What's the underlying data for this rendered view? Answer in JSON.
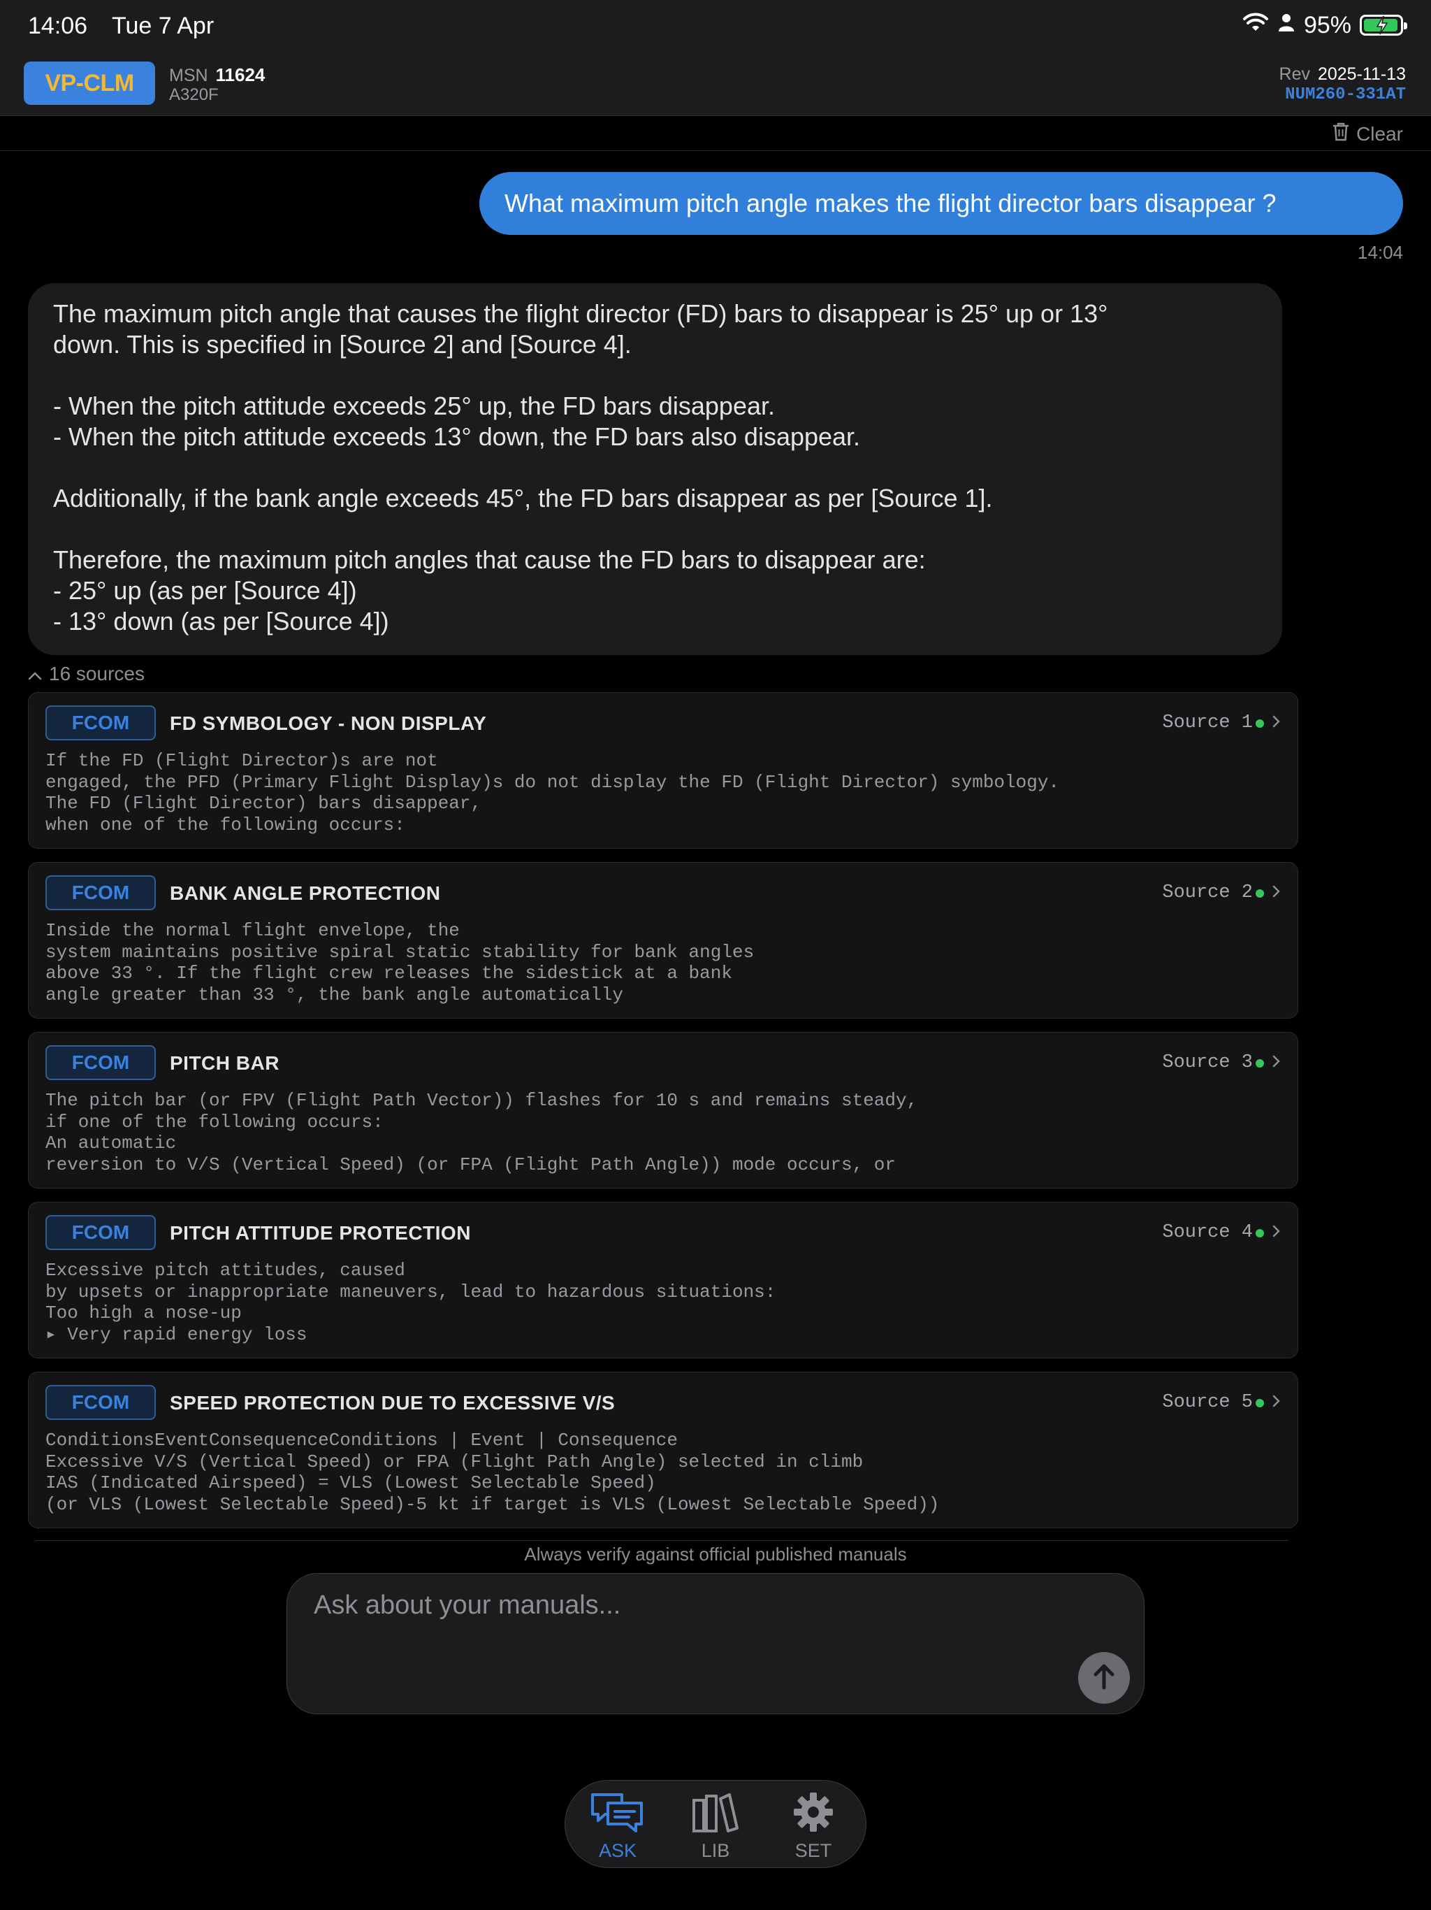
{
  "status_bar": {
    "time": "14:06",
    "date": "Tue 7 Apr",
    "battery": "95%"
  },
  "header": {
    "registration": "VP-CLM",
    "msn_label": "MSN",
    "msn_value": "11624",
    "model": "A320F",
    "rev_label": "Rev",
    "rev_date": "2025-11-13",
    "rev_code": "NUM260-331AT"
  },
  "toolbar": {
    "clear_label": "Clear"
  },
  "chat": {
    "user_message": "What maximum pitch angle makes the flight director bars disappear ?",
    "user_time": "14:04",
    "assistant_lines": [
      "The maximum pitch angle that causes the flight director (FD) bars to disappear is 25° up or 13°",
      "down. This is specified in [Source 2] and [Source 4].",
      "- When the pitch attitude exceeds 25° up, the FD bars disappear.",
      "- When the pitch attitude exceeds 13° down, the FD bars also disappear.",
      "Additionally, if the bank angle exceeds 45°, the FD bars disappear as per [Source 1].",
      "Therefore, the maximum pitch angles that cause the FD bars to disappear are:",
      "- 25° up (as per [Source 4])",
      "- 13° down (as per [Source 4])"
    ]
  },
  "sources": {
    "toggle_label": "16 sources",
    "items": [
      {
        "badge": "FCOM",
        "title": "FD SYMBOLOGY - NON DISPLAY",
        "label": "Source 1",
        "lines": [
          "If the FD (Flight Director)s are not",
          "engaged, the PFD (Primary Flight Display)s do not display the FD (Flight Director) symbology.",
          "The FD (Flight Director) bars disappear,",
          "when one of the following occurs:"
        ]
      },
      {
        "badge": "FCOM",
        "title": "BANK ANGLE PROTECTION",
        "label": "Source 2",
        "lines": [
          "Inside the normal flight envelope, the",
          "system maintains positive spiral static stability for bank angles",
          "above 33 °. If the flight crew releases the sidestick at a bank",
          "angle greater than 33 °, the bank angle automatically"
        ]
      },
      {
        "badge": "FCOM",
        "title": "PITCH BAR",
        "label": "Source 3",
        "lines": [
          "The pitch bar (or FPV (Flight Path Vector)) flashes for 10 s and remains steady,",
          "if one of the following occurs:",
          "An automatic",
          "reversion to V/S (Vertical Speed) (or FPA (Flight Path Angle)) mode occurs, or"
        ]
      },
      {
        "badge": "FCOM",
        "title": "PITCH ATTITUDE PROTECTION",
        "label": "Source 4",
        "lines": [
          "Excessive pitch attitudes, caused",
          "by upsets or inappropriate maneuvers, lead to hazardous situations:",
          "Too high a nose-up",
          "▸ Very rapid energy loss"
        ]
      },
      {
        "badge": "FCOM",
        "title": "SPEED PROTECTION DUE TO EXCESSIVE V/S",
        "label": "Source 5",
        "lines": [
          "ConditionsEventConsequenceConditions | Event | Consequence",
          "Excessive V/S (Vertical Speed) or FPA (Flight Path Angle) selected in climb",
          "IAS (Indicated Airspeed) = VLS (Lowest Selectable Speed)",
          "(or VLS (Lowest Selectable Speed)-5 kt if target is VLS (Lowest Selectable Speed))"
        ]
      }
    ]
  },
  "composer": {
    "disclaimer": "Always verify against official published manuals",
    "placeholder": "Ask about your manuals..."
  },
  "tabbar": {
    "ask": "ASK",
    "lib": "LIB",
    "set": "SET"
  },
  "colors": {
    "accent": "#3a82dd",
    "registration_text": "#f5b82e",
    "status_ok": "#34c759"
  }
}
